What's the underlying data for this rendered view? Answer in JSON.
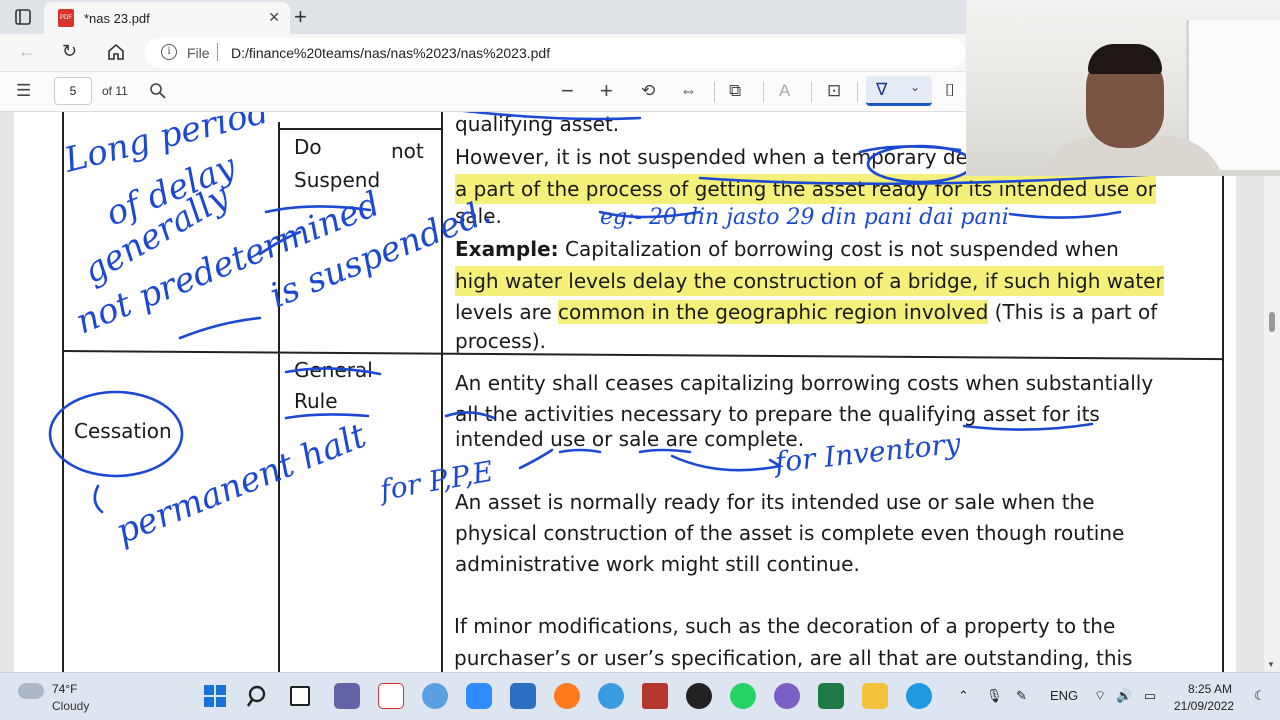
{
  "browser": {
    "tab_title": "*nas 23.pdf",
    "address_file_label": "File",
    "address_url": "D:/finance%20teams/nas/nas%2023/nas%2023.pdf"
  },
  "pdf_toolbar": {
    "page_current": "5",
    "page_total": "of 11"
  },
  "document": {
    "row1": {
      "col2_line1_left": "Do",
      "col2_line1_right": "not",
      "col2_line2": "Suspend",
      "line0": "qualifying asset.",
      "line1": "However, it is not suspended when a temporary delay is necessary as",
      "line2_hl": "a part of the process of getting the asset ready for its intended use or",
      "line3": "sale.",
      "example_label": "Example:",
      "example_line1": " Capitalization of borrowing cost is not suspended when",
      "example_line2_hl": "high water levels delay the construction of a bridge, if such high water",
      "example_line3a": "levels are ",
      "example_line3_hl": "common in the geographic region involved",
      "example_line3b": " (This is a part of",
      "example_line4": "process)."
    },
    "row2": {
      "col1": "Cessation",
      "col2_line1": "General",
      "col2_line2": "Rule",
      "p1_line1": "An entity shall ceases capitalizing borrowing costs when substantially",
      "p1_line2": "all the activities necessary to prepare the qualifying asset for its",
      "p1_line3": "intended use or sale are complete.",
      "p2_line1": "An asset is normally ready for its intended use or sale when the",
      "p2_line2": "physical construction of the asset is complete even though routine",
      "p2_line3": "administrative work might still continue.",
      "p3_line1": "If minor modifications, such as the decoration of a property to the",
      "p3_line2": "purchaser’s or user’s specification, are all that are outstanding, this"
    },
    "annotations": {
      "a1": "Long period",
      "a2": "of delay",
      "a3": "generally",
      "a4": "not predetermined",
      "a5": "is suspended.",
      "a6": "eg:- 20 din jasto 29 din pani dai pani",
      "a7": "permanent halt",
      "a8": "for P,P,E",
      "a9": "for Inventory"
    }
  },
  "taskbar": {
    "weather_temp": "74°F",
    "weather_cond": "Cloudy",
    "lang": "ENG",
    "time": "8:25 AM",
    "date": "21/09/2022"
  },
  "colors": {
    "ink": "#1b49d4",
    "highlight": "#f5f07a",
    "active_tool": "#1a57c2"
  }
}
